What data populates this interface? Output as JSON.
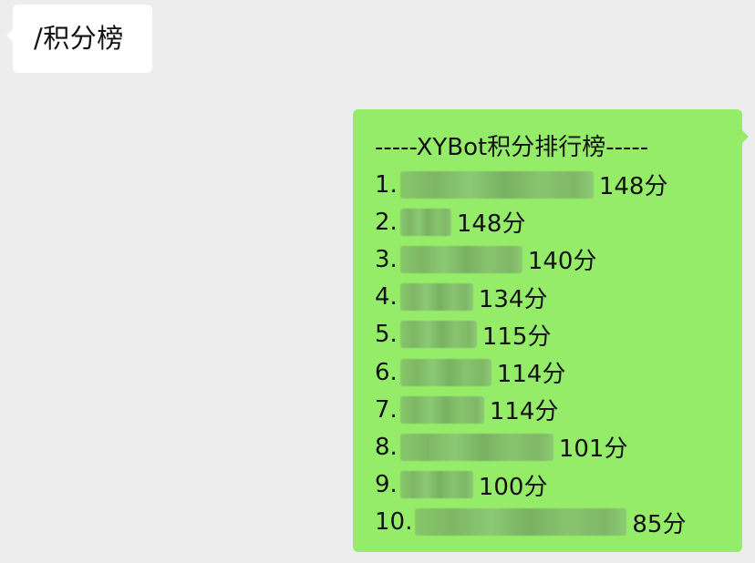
{
  "chat": {
    "incoming_message": "/积分榜",
    "outgoing": {
      "title": "-----XYBot积分排行榜-----",
      "rows": [
        {
          "rank": "1.",
          "score": "148分",
          "blur_width": 212
        },
        {
          "rank": "2.",
          "score": "148分",
          "blur_width": 56
        },
        {
          "rank": "3.",
          "score": "140分",
          "blur_width": 134
        },
        {
          "rank": "4.",
          "score": "134分",
          "blur_width": 80
        },
        {
          "rank": "5.",
          "score": "115分",
          "blur_width": 84
        },
        {
          "rank": "6.",
          "score": "114分",
          "blur_width": 100
        },
        {
          "rank": "7.",
          "score": "114分",
          "blur_width": 92
        },
        {
          "rank": "8.",
          "score": "101分",
          "blur_width": 168
        },
        {
          "rank": "9.",
          "score": "100分",
          "blur_width": 80
        },
        {
          "rank": "10.",
          "score": "85分",
          "blur_width": 232
        }
      ]
    }
  },
  "colors": {
    "background": "#ededed",
    "incoming_bubble": "#ffffff",
    "outgoing_bubble": "#95ec69",
    "text": "#111111"
  }
}
